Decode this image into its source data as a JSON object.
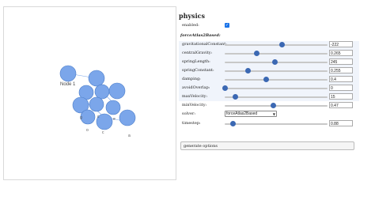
{
  "network": {
    "nodes": [
      {
        "id": "node1",
        "label": "Node 1"
      },
      {
        "id": "n2",
        "label": ""
      },
      {
        "id": "n3",
        "label": ""
      },
      {
        "id": "n4",
        "label": ""
      },
      {
        "id": "n5",
        "label": ""
      },
      {
        "id": "n6",
        "label": ""
      },
      {
        "id": "n7",
        "label": ""
      },
      {
        "id": "n8",
        "label": ""
      },
      {
        "id": "n9",
        "label": ""
      },
      {
        "id": "n10",
        "label": ""
      }
    ],
    "edge_labels": [
      "o",
      "c",
      "a",
      "e",
      "g",
      "c"
    ],
    "node_color": "#7ba6ea",
    "node_border_color": "#4a7cc8"
  },
  "config": {
    "title": "physics",
    "enabled_label": "enabled:",
    "enabled": true,
    "solver_section_label": "forceAtlas2Based:",
    "sliders": [
      {
        "key": "gravitationalConstant",
        "label": "gravitationalConstant:",
        "value": "-222",
        "fraction": 0.56
      },
      {
        "key": "centralGravity",
        "label": "centralGravity:",
        "value": "0.265",
        "fraction": 0.31
      },
      {
        "key": "springLength",
        "label": "springLength:",
        "value": "245",
        "fraction": 0.49
      },
      {
        "key": "springConstant",
        "label": "springConstant:",
        "value": "0.255",
        "fraction": 0.23
      },
      {
        "key": "damping",
        "label": "damping:",
        "value": "0.4",
        "fraction": 0.4
      },
      {
        "key": "avoidOverlap",
        "label": "avoidOverlap:",
        "value": "0",
        "fraction": 0.0
      },
      {
        "key": "maxVelocity",
        "label": "maxVelocity:",
        "value": "15",
        "fraction": 0.1
      },
      {
        "key": "minVelocity",
        "label": "minVelocity:",
        "value": "0.47",
        "fraction": 0.47
      }
    ],
    "solver_label": "solver:",
    "solver_value": "forceAtlas2Based",
    "timestep_label": "timestep:",
    "timestep_value": "0.88",
    "timestep_fraction": 0.08,
    "generate_label": "generate options"
  }
}
